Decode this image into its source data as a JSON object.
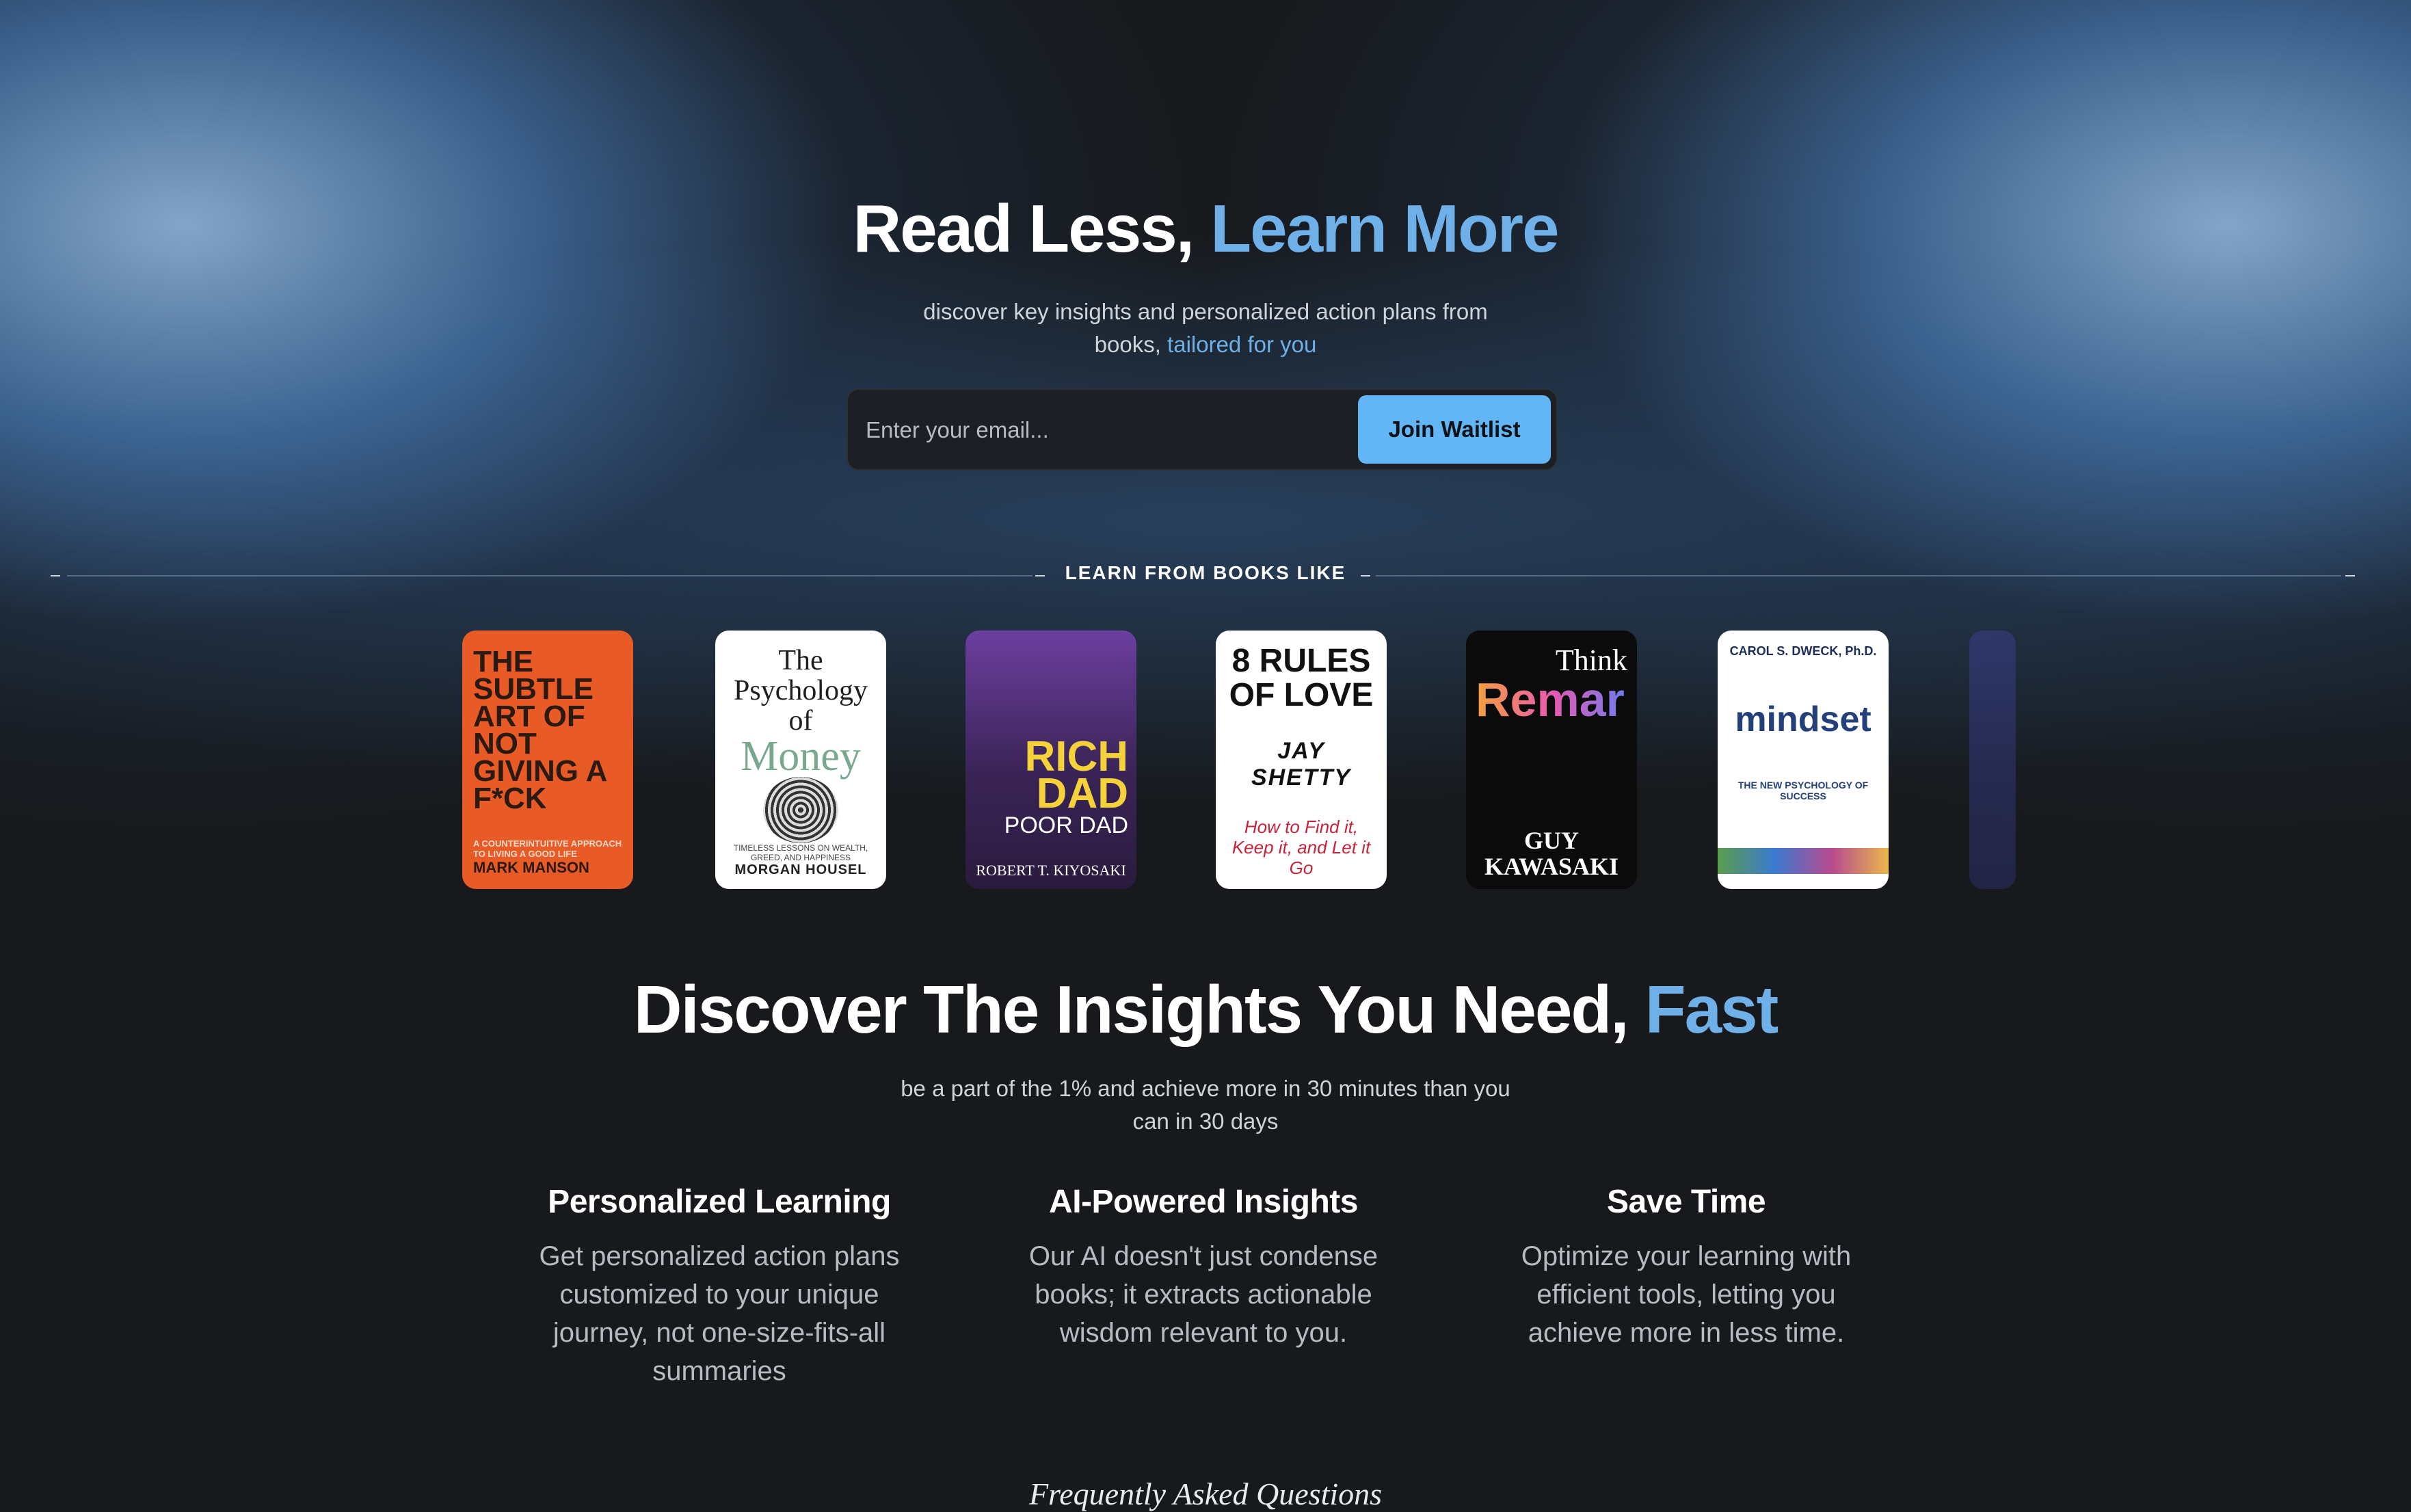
{
  "hero": {
    "title_part1": "Read Less, ",
    "title_accent": "Learn More",
    "subtitle_line1": "discover key insights and personalized action plans from",
    "subtitle_line2_prefix": "books, ",
    "subtitle_line2_accent": "tailored for you"
  },
  "waitlist": {
    "email_placeholder": "Enter your email...",
    "button_label": "Join Waitlist"
  },
  "books_section": {
    "label": "LEARN FROM BOOKS LIKE",
    "books": [
      {
        "title": "THE SUBTLE ART OF NOT GIVING A F*CK",
        "subtitle": "A COUNTERINTUITIVE APPROACH TO LIVING A GOOD LIFE",
        "author": "MARK MANSON"
      },
      {
        "title_line1": "The Psychology of",
        "title_line2": "Money",
        "subtitle": "TIMELESS LESSONS ON WEALTH, GREED, AND HAPPINESS",
        "author": "MORGAN HOUSEL"
      },
      {
        "title_line1": "RICH DAD",
        "title_line2": "POOR DAD",
        "author": "ROBERT T. KIYOSAKI"
      },
      {
        "title": "8 RULES OF LOVE",
        "author": "JAY SHETTY",
        "subtitle": "How to Find it, Keep it, and Let it Go"
      },
      {
        "title_line1": "Think",
        "title_line2": "Remarkable",
        "author": "GUY KAWASAKI"
      },
      {
        "author": "CAROL S. DWECK, Ph.D.",
        "title": "mindset",
        "subtitle": "THE NEW PSYCHOLOGY OF SUCCESS"
      }
    ]
  },
  "insights": {
    "title_part1": "Discover The Insights You Need, ",
    "title_accent": "Fast",
    "subtitle_line1": "be a part of the 1% and achieve more in 30 minutes than you",
    "subtitle_line2": "can in 30 days"
  },
  "features": [
    {
      "title": "Personalized Learning",
      "line1": "Get personalized action plans",
      "line2": "customized to your unique",
      "line3": "journey, not one-size-fits-all",
      "line4": "summaries"
    },
    {
      "title": "AI-Powered Insights",
      "line1": "Our AI doesn't just condense",
      "line2": "books; it extracts actionable",
      "line3": "wisdom relevant to you."
    },
    {
      "title": "Save Time",
      "line1": "Optimize your learning with",
      "line2": "efficient tools, letting you",
      "line3": "achieve more in less time."
    }
  ],
  "faq": {
    "title": "Frequently Asked Questions"
  },
  "colors": {
    "accent": "#6fb0e8",
    "button": "#62b6f6",
    "background": "#17191c"
  }
}
